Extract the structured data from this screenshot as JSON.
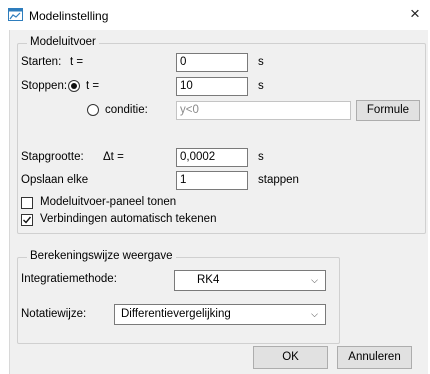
{
  "window": {
    "title": "Modelinstelling",
    "close_glyph": "×"
  },
  "output_group": {
    "legend": "Modeluitvoer",
    "start_label": "Starten:",
    "start_var": "t =",
    "start_value": "0",
    "start_unit": "s",
    "stop_label": "Stoppen:",
    "stop_option_time": "t =",
    "stop_value": "10",
    "stop_unit": "s",
    "stop_option_condition": "conditie:",
    "condition_placeholder": "y<0",
    "formula_button": "Formule",
    "step_label": "Stapgrootte:",
    "step_var": "Δt =",
    "step_value": "0,0002",
    "step_unit": "s",
    "save_label": "Opslaan elke",
    "save_value": "1",
    "save_unit": "stappen",
    "show_panel_label": "Modeluitvoer-paneel tonen",
    "show_panel_checked": false,
    "auto_connect_label": "Verbindingen automatisch tekenen",
    "auto_connect_checked": true
  },
  "calc_group": {
    "legend": "Berekeningswijze  weergave",
    "integration_label": "Integratiemethode:",
    "integration_value": "RK4",
    "notation_label": "Notatiewijze:",
    "notation_value": "Differentievergelijking"
  },
  "footer": {
    "ok_label": "OK",
    "cancel_label": "Annuleren"
  },
  "icons": {
    "app": "model-settings-icon",
    "dropdown": "chevron-down-icon",
    "close": "close-icon"
  },
  "colors": {
    "dialog_bg": "#f0f0f0",
    "app_icon": "#2e7dbd"
  }
}
